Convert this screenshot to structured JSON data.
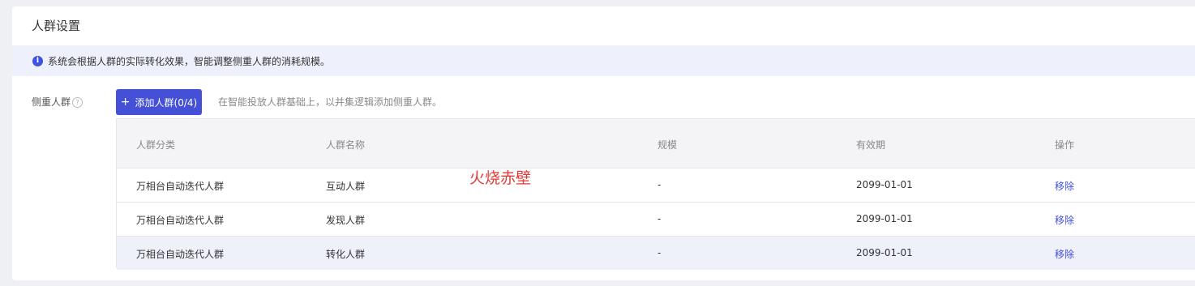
{
  "card": {
    "title": "人群设置"
  },
  "notice": {
    "icon": "info-icon",
    "text": "系统会根据人群的实际转化效果，智能调整侧重人群的消耗规模。"
  },
  "focus_crowd": {
    "label": "侧重人群",
    "help_icon": "question-circle-icon",
    "add_button_label": "添加人群(0/4)",
    "hint": "在智能投放人群基础上，以并集逻辑添加侧重人群。"
  },
  "table": {
    "headers": [
      "人群分类",
      "人群名称",
      "规模",
      "有效期",
      "操作"
    ],
    "rows": [
      {
        "category": "万相台自动迭代人群",
        "name": "互动人群",
        "scale": "-",
        "validity": "2099-01-01",
        "action": "移除"
      },
      {
        "category": "万相台自动迭代人群",
        "name": "发现人群",
        "scale": "-",
        "validity": "2099-01-01",
        "action": "移除"
      },
      {
        "category": "万相台自动迭代人群",
        "name": "转化人群",
        "scale": "-",
        "validity": "2099-01-01",
        "action": "移除"
      }
    ]
  },
  "watermark": "火烧赤壁",
  "colors": {
    "accent": "#4450d6",
    "notice_bg": "#eef0fb",
    "watermark": "#e53935"
  }
}
